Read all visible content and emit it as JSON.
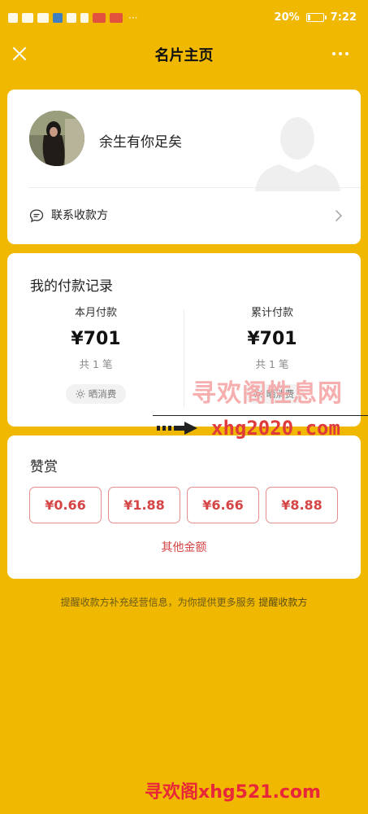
{
  "status_bar": {
    "battery": "20%",
    "time": "7:22",
    "battery_level": 0.2,
    "notification_dots": "···"
  },
  "nav": {
    "title": "名片主页",
    "close_icon": "close-icon",
    "more_icon": "more-icon"
  },
  "profile": {
    "username": "余生有你足矣",
    "contact_label": "联系收款方"
  },
  "payments": {
    "title": "我的付款记录",
    "this_month": {
      "label": "本月付款",
      "amount": "¥701",
      "count": "共 1 笔",
      "share_label": "晒消费"
    },
    "total": {
      "label": "累计付款",
      "amount": "¥701",
      "count": "共 1 笔",
      "share_label": "晒消费"
    }
  },
  "reward": {
    "title": "赞赏",
    "amounts": [
      "¥0.66",
      "¥1.88",
      "¥6.66",
      "¥8.88"
    ],
    "other_label": "其他金额"
  },
  "footer": {
    "note": "提醒收款方补充经营信息，为你提供更多服务",
    "link": "提醒收款方"
  },
  "watermarks": {
    "top": "寻欢阁性息网",
    "middle": "xhg2020.com",
    "bottom": "寻欢阁xhg521.com"
  },
  "colors": {
    "background": "#f0b800",
    "accent_red": "#d64545"
  }
}
